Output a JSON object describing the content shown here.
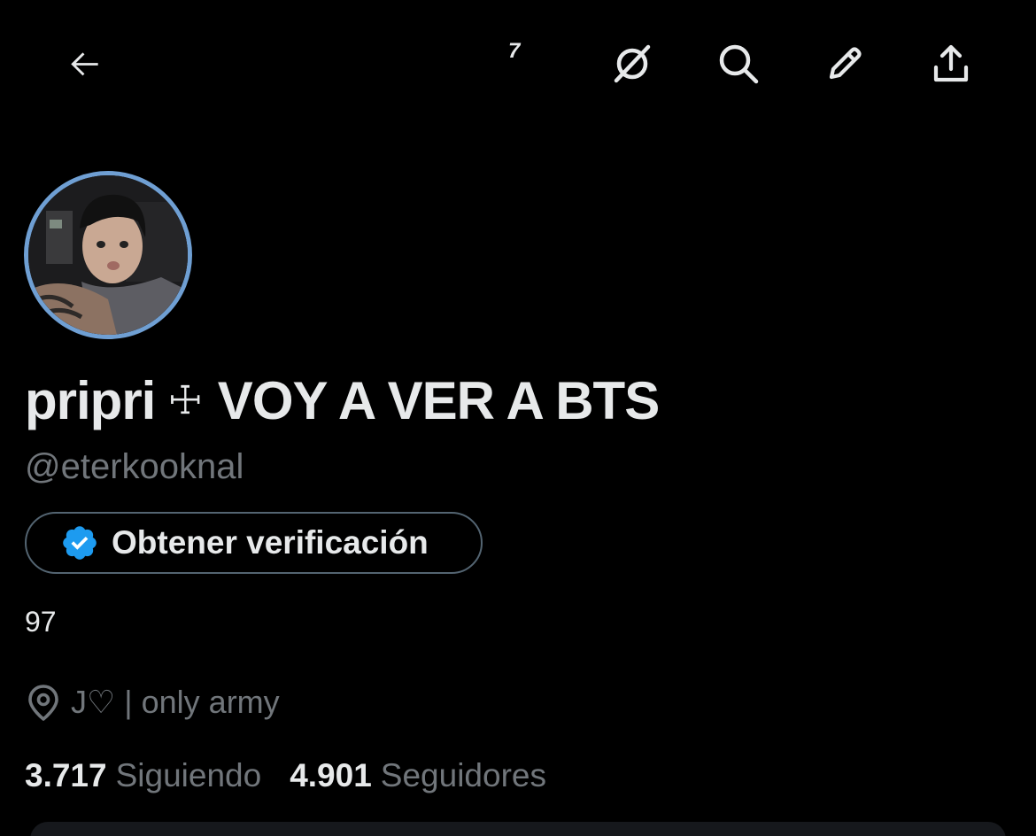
{
  "header": {
    "notification_count": "7"
  },
  "profile": {
    "display_name": "pripri",
    "name_symbol": "☩",
    "display_name_suffix": "VOY A VER A BTS",
    "handle": "@eterkooknal",
    "verify_label": "Obtener verificación",
    "bio": "97",
    "location": "J♡ | only army",
    "following_count": "3.717",
    "following_label": "Siguiendo",
    "followers_count": "4.901",
    "followers_label": "Seguidores"
  },
  "colors": {
    "background": "#000000",
    "primary_text": "#e7e9ea",
    "secondary_text": "#71767b",
    "verified_blue": "#1d9bf0",
    "avatar_ring": "#6f9fd3"
  },
  "icons": {
    "back": "arrow-left-icon",
    "grok": "grok-icon",
    "search": "search-icon",
    "edit": "pencil-icon",
    "share": "share-icon",
    "verified": "verified-badge-icon",
    "location": "location-pin-icon"
  }
}
